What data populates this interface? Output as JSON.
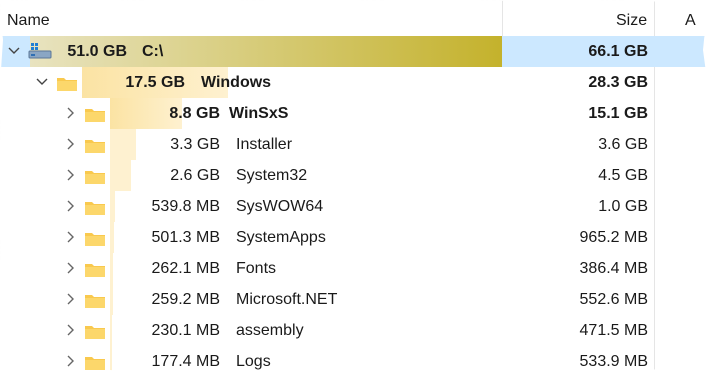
{
  "header": {
    "name_col": "Name",
    "size_col": "Size",
    "extra_col": "A"
  },
  "colors": {
    "selection": "#cce8ff",
    "drive_bar_start": "#e8e3c0",
    "drive_bar_end": "#c4b22c",
    "folder_bar_dark": "#fbe3a3",
    "folder_bar_light": "#fef1d0",
    "folder_icon": "#f9c94e"
  },
  "rows": [
    {
      "level": 0,
      "chevron": "down",
      "icon": "drive-icon",
      "allocated": "51.0 GB",
      "name": "C:\\",
      "size": "66.1 GB",
      "bold": true,
      "selected": true
    },
    {
      "level": 1,
      "chevron": "down",
      "icon": "folder-icon",
      "allocated": "17.5 GB",
      "name": "Windows",
      "size": "28.3 GB",
      "bold": true,
      "selected": false
    },
    {
      "level": 2,
      "chevron": "right",
      "icon": "folder-icon",
      "allocated": "8.8 GB",
      "name": "WinSxS",
      "size": "15.1 GB",
      "bold": true,
      "selected": false
    },
    {
      "level": 2,
      "chevron": "right",
      "icon": "folder-icon",
      "allocated": "3.3 GB",
      "name": "Installer",
      "size": "3.6 GB",
      "bold": false,
      "selected": false
    },
    {
      "level": 2,
      "chevron": "right",
      "icon": "folder-icon",
      "allocated": "2.6 GB",
      "name": "System32",
      "size": "4.5 GB",
      "bold": false,
      "selected": false
    },
    {
      "level": 2,
      "chevron": "right",
      "icon": "folder-icon",
      "allocated": "539.8 MB",
      "name": "SysWOW64",
      "size": "1.0 GB",
      "bold": false,
      "selected": false
    },
    {
      "level": 2,
      "chevron": "right",
      "icon": "folder-icon",
      "allocated": "501.3 MB",
      "name": "SystemApps",
      "size": "965.2 MB",
      "bold": false,
      "selected": false
    },
    {
      "level": 2,
      "chevron": "right",
      "icon": "folder-icon",
      "allocated": "262.1 MB",
      "name": "Fonts",
      "size": "386.4 MB",
      "bold": false,
      "selected": false
    },
    {
      "level": 2,
      "chevron": "right",
      "icon": "folder-icon",
      "allocated": "259.2 MB",
      "name": "Microsoft.NET",
      "size": "552.6 MB",
      "bold": false,
      "selected": false
    },
    {
      "level": 2,
      "chevron": "right",
      "icon": "folder-icon",
      "allocated": "230.1 MB",
      "name": "assembly",
      "size": "471.5 MB",
      "bold": false,
      "selected": false
    },
    {
      "level": 2,
      "chevron": "right",
      "icon": "folder-icon",
      "allocated": "177.4 MB",
      "name": "Logs",
      "size": "533.9 MB",
      "bold": false,
      "selected": false
    }
  ]
}
